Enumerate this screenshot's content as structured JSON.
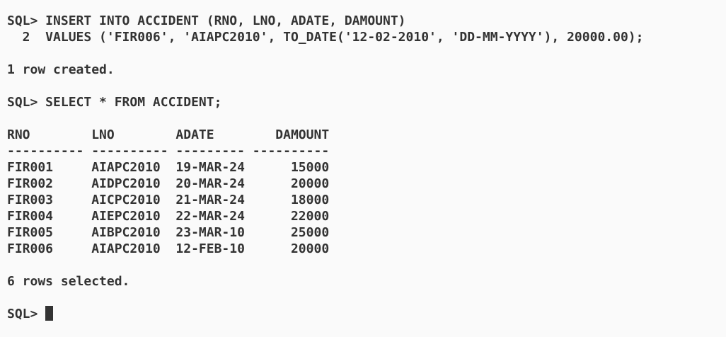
{
  "terminal": {
    "insert_stmt": {
      "line1": "SQL> INSERT INTO ACCIDENT (RNO, LNO, ADATE, DAMOUNT)",
      "line2": "  2  VALUES ('FIR006', 'AIAPC2010', TO_DATE('12-02-2010', 'DD-MM-YYYY'), 20000.00);"
    },
    "insert_result": "1 row created.",
    "select_stmt": "SQL> SELECT * FROM ACCIDENT;",
    "table": {
      "header": "RNO        LNO        ADATE        DAMOUNT",
      "separator": "---------- ---------- --------- ----------",
      "rows": [
        "FIR001     AIAPC2010  19-MAR-24      15000",
        "FIR002     AIDPC2010  20-MAR-24      20000",
        "FIR003     AICPC2010  21-MAR-24      18000",
        "FIR004     AIEPC2010  22-MAR-24      22000",
        "FIR005     AIBPC2010  23-MAR-10      25000",
        "FIR006     AIAPC2010  12-FEB-10      20000"
      ]
    },
    "select_result": "6 rows selected.",
    "prompt": "SQL> "
  }
}
